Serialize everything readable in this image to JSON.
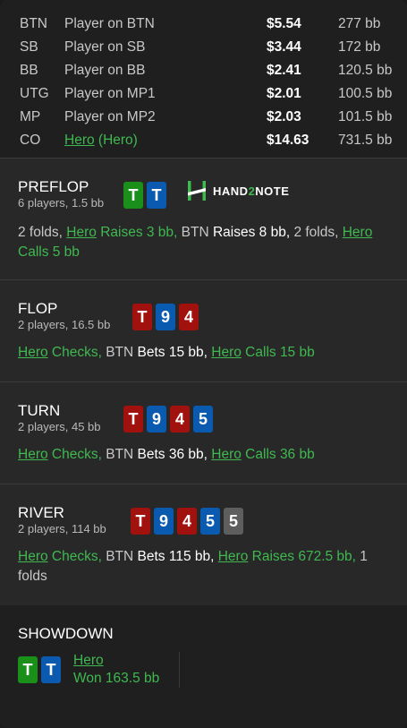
{
  "players": [
    {
      "pos": "BTN",
      "name": "Player on BTN",
      "stack": "$5.54",
      "bb": "277 bb",
      "hero": false
    },
    {
      "pos": "SB",
      "name": "Player on SB",
      "stack": "$3.44",
      "bb": "172 bb",
      "hero": false
    },
    {
      "pos": "BB",
      "name": "Player on BB",
      "stack": "$2.41",
      "bb": "120.5 bb",
      "hero": false
    },
    {
      "pos": "UTG",
      "name": "Player on MP1",
      "stack": "$2.01",
      "bb": "100.5 bb",
      "hero": false
    },
    {
      "pos": "MP",
      "name": "Player on MP2",
      "stack": "$2.03",
      "bb": "101.5 bb",
      "hero": false
    },
    {
      "pos": "CO",
      "name": "Hero",
      "name_suffix": " (Hero)",
      "stack": "$14.63",
      "bb": "731.5 bb",
      "hero": true
    }
  ],
  "logo": {
    "part1": "HAND",
    "part2": "2",
    "part3": "NOTE"
  },
  "streets": {
    "preflop": {
      "title": "PREFLOP",
      "sub": "6 players, 1.5 bb",
      "cards": [
        {
          "r": "T",
          "suit": "clubs"
        },
        {
          "r": "T",
          "suit": "diamonds"
        }
      ],
      "actions": [
        {
          "t": "2 folds, ",
          "cls": ""
        },
        {
          "t": "Hero",
          "cls": "green ulink"
        },
        {
          "t": " Raises 3 bb, ",
          "cls": "green"
        },
        {
          "t": "BTN ",
          "cls": ""
        },
        {
          "t": "Raises 8 bb, ",
          "cls": "w"
        },
        {
          "t": "2 folds, ",
          "cls": ""
        },
        {
          "t": "Hero",
          "cls": "green ulink"
        },
        {
          "t": " Calls 5 bb",
          "cls": "green"
        }
      ]
    },
    "flop": {
      "title": "FLOP",
      "sub": "2 players, 16.5 bb",
      "cards": [
        {
          "r": "T",
          "suit": "hearts"
        },
        {
          "r": "9",
          "suit": "diamonds"
        },
        {
          "r": "4",
          "suit": "hearts"
        }
      ],
      "actions": [
        {
          "t": "Hero",
          "cls": "green ulink"
        },
        {
          "t": " Checks, ",
          "cls": "green"
        },
        {
          "t": "BTN ",
          "cls": ""
        },
        {
          "t": "Bets 15 bb, ",
          "cls": "w"
        },
        {
          "t": "Hero",
          "cls": "green ulink"
        },
        {
          "t": " Calls 15 bb",
          "cls": "green"
        }
      ]
    },
    "turn": {
      "title": "TURN",
      "sub": "2 players, 45 bb",
      "cards": [
        {
          "r": "T",
          "suit": "hearts"
        },
        {
          "r": "9",
          "suit": "diamonds"
        },
        {
          "r": "4",
          "suit": "hearts"
        },
        {
          "r": "5",
          "suit": "diamonds"
        }
      ],
      "actions": [
        {
          "t": "Hero",
          "cls": "green ulink"
        },
        {
          "t": " Checks, ",
          "cls": "green"
        },
        {
          "t": "BTN ",
          "cls": ""
        },
        {
          "t": "Bets 36 bb, ",
          "cls": "w"
        },
        {
          "t": "Hero",
          "cls": "green ulink"
        },
        {
          "t": " Calls 36 bb",
          "cls": "green"
        }
      ]
    },
    "river": {
      "title": "RIVER",
      "sub": "2 players, 114 bb",
      "cards": [
        {
          "r": "T",
          "suit": "hearts"
        },
        {
          "r": "9",
          "suit": "diamonds"
        },
        {
          "r": "4",
          "suit": "hearts"
        },
        {
          "r": "5",
          "suit": "diamonds"
        },
        {
          "r": "5",
          "suit": "spades"
        }
      ],
      "actions": [
        {
          "t": "Hero",
          "cls": "green ulink"
        },
        {
          "t": " Checks, ",
          "cls": "green"
        },
        {
          "t": "BTN ",
          "cls": ""
        },
        {
          "t": "Bets 115 bb, ",
          "cls": "w"
        },
        {
          "t": "Hero",
          "cls": "green ulink"
        },
        {
          "t": " Raises 672.5 bb, ",
          "cls": "green"
        },
        {
          "t": "1 folds",
          "cls": ""
        }
      ]
    }
  },
  "showdown": {
    "title": "SHOWDOWN",
    "cards": [
      {
        "r": "T",
        "suit": "clubs"
      },
      {
        "r": "T",
        "suit": "diamonds"
      }
    ],
    "name": "Hero",
    "won": "Won 163.5 bb"
  },
  "colors": {
    "hearts": "#a1120f",
    "diamonds": "#0a5ab0",
    "clubs": "#1a8f1a",
    "spades": "#5e5e5e",
    "accent_green": "#3fb950",
    "background": "#1f1f1f",
    "panel": "#282828"
  }
}
